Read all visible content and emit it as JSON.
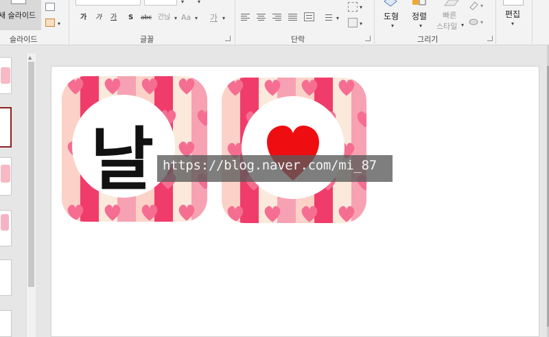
{
  "ribbon": {
    "slides_group": {
      "new_slide_label": "새 슬라이드",
      "group_label": "슬라이드"
    },
    "font_group": {
      "group_label": "글꼴",
      "buttons": [
        {
          "label": "가",
          "name": "bold-button"
        },
        {
          "label": "가",
          "name": "italic-button"
        },
        {
          "label": "가",
          "name": "underline-button"
        },
        {
          "label": "S",
          "name": "shadow-button"
        },
        {
          "label": "abc",
          "name": "strikethrough-button"
        },
        {
          "label": "간닎",
          "name": "char-spacing-button"
        },
        {
          "label": "Aa",
          "name": "change-case-button"
        },
        {
          "label": "가",
          "name": "font-color-button"
        }
      ]
    },
    "paragraph_group": {
      "group_label": "단락"
    },
    "drawing_group": {
      "group_label": "그리기",
      "shapes_label": "도형",
      "arrange_label": "정렬",
      "quick_styles_line1": "빠른",
      "quick_styles_line2": "스타일"
    },
    "editing_group": {
      "label": "편집"
    }
  },
  "watermark": {
    "text": "https://blog.naver.com/mi_87"
  },
  "cards": [
    {
      "name": "nal-card",
      "character": "날"
    },
    {
      "name": "heart-card",
      "character": ""
    }
  ],
  "colors": {
    "stripe_light": "#fcd2c8",
    "stripe_dark": "#f03c6a",
    "stripe_cream": "#fbe9dc",
    "stripe_rose": "#f7a2b2",
    "heart_pink": "#f56e92",
    "heart_red": "#ee0e12",
    "selected_thumb": "#8b1e1e"
  }
}
